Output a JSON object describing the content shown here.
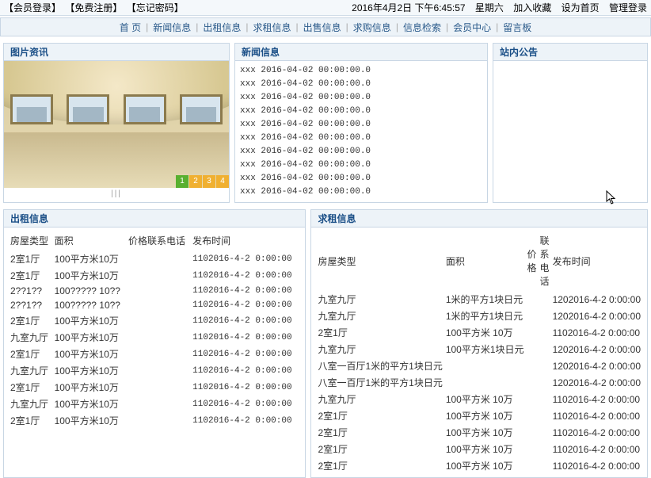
{
  "topbar": {
    "login": "【会员登录】",
    "register": "【免费注册】",
    "forgot": "【忘记密码】",
    "date": "2016年4月2日 下午6:45:57",
    "weekday": "星期六",
    "fav": "加入收藏",
    "home": "设为首页",
    "admin": "管理登录"
  },
  "nav": {
    "items": [
      "首 页",
      "新闻信息",
      "出租信息",
      "求租信息",
      "出售信息",
      "求购信息",
      "信息检索",
      "会员中心",
      "留言板"
    ]
  },
  "photo_panel": {
    "title": "图片资讯",
    "pager": [
      "1",
      "2",
      "3",
      "4"
    ],
    "pager_active": 0,
    "footer": "|||"
  },
  "news_panel": {
    "title": "新闻信息",
    "items": [
      "xxx 2016-04-02 00:00:00.0",
      "xxx 2016-04-02 00:00:00.0",
      "xxx 2016-04-02 00:00:00.0",
      "xxx 2016-04-02 00:00:00.0",
      "xxx 2016-04-02 00:00:00.0",
      "xxx 2016-04-02 00:00:00.0",
      "xxx 2016-04-02 00:00:00.0",
      "xxx 2016-04-02 00:00:00.0",
      "xxx 2016-04-02 00:00:00.0",
      "xxx 2016-04-02 00:00:00.0"
    ]
  },
  "side_panel": {
    "title": "站内公告"
  },
  "rent_out": {
    "title": "出租信息",
    "headers": [
      "房屋类型",
      "面积",
      "价格联系电话",
      "发布时间"
    ],
    "rows": [
      [
        "2室1厅",
        "100平方米10万",
        "",
        "1102016-4-2 0:00:00"
      ],
      [
        "2室1厅",
        "100平方米10万",
        "",
        "1102016-4-2 0:00:00"
      ],
      [
        "2??1??",
        "100????? 10??",
        "",
        "1102016-4-2 0:00:00"
      ],
      [
        "2??1??",
        "100????? 10??",
        "",
        "1102016-4-2 0:00:00"
      ],
      [
        "2室1厅",
        "100平方米10万",
        "",
        "1102016-4-2 0:00:00"
      ],
      [
        "九室九厅",
        "100平方米10万",
        "",
        "1102016-4-2 0:00:00"
      ],
      [
        "2室1厅",
        "100平方米10万",
        "",
        "1102016-4-2 0:00:00"
      ],
      [
        "九室九厅",
        "100平方米10万",
        "",
        "1102016-4-2 0:00:00"
      ],
      [
        "2室1厅",
        "100平方米10万",
        "",
        "1102016-4-2 0:00:00"
      ],
      [
        "九室九厅",
        "100平方米10万",
        "",
        "1102016-4-2 0:00:00"
      ],
      [
        "2室1厅",
        "100平方米10万",
        "",
        "1102016-4-2 0:00:00"
      ]
    ]
  },
  "rent_seek": {
    "title": "求租信息",
    "headers": [
      "房屋类型",
      "面积",
      "价格",
      "联系电话",
      "发布时间"
    ],
    "rows": [
      [
        "九室九厅",
        "1米的平方1块日元",
        "",
        "",
        "1202016-4-2 0:00:00"
      ],
      [
        "九室九厅",
        "1米的平方1块日元",
        "",
        "",
        "1202016-4-2 0:00:00"
      ],
      [
        "2室1厅",
        "100平方米 10万",
        "",
        "",
        "1102016-4-2 0:00:00"
      ],
      [
        "九室九厅",
        "100平方米1块日元",
        "",
        "",
        "1202016-4-2 0:00:00"
      ],
      [
        "八室一百厅1米的平方1块日元",
        "",
        "",
        "",
        "1202016-4-2 0:00:00"
      ],
      [
        "八室一百厅1米的平方1块日元",
        "",
        "",
        "",
        "1202016-4-2 0:00:00"
      ],
      [
        "九室九厅",
        "100平方米 10万",
        "",
        "",
        "1102016-4-2 0:00:00"
      ],
      [
        "2室1厅",
        "100平方米 10万",
        "",
        "",
        "1102016-4-2 0:00:00"
      ],
      [
        "2室1厅",
        "100平方米 10万",
        "",
        "",
        "1102016-4-2 0:00:00"
      ],
      [
        "2室1厅",
        "100平方米 10万",
        "",
        "",
        "1102016-4-2 0:00:00"
      ],
      [
        "2室1厅",
        "100平方米 10万",
        "",
        "",
        "1102016-4-2 0:00:00"
      ]
    ]
  }
}
